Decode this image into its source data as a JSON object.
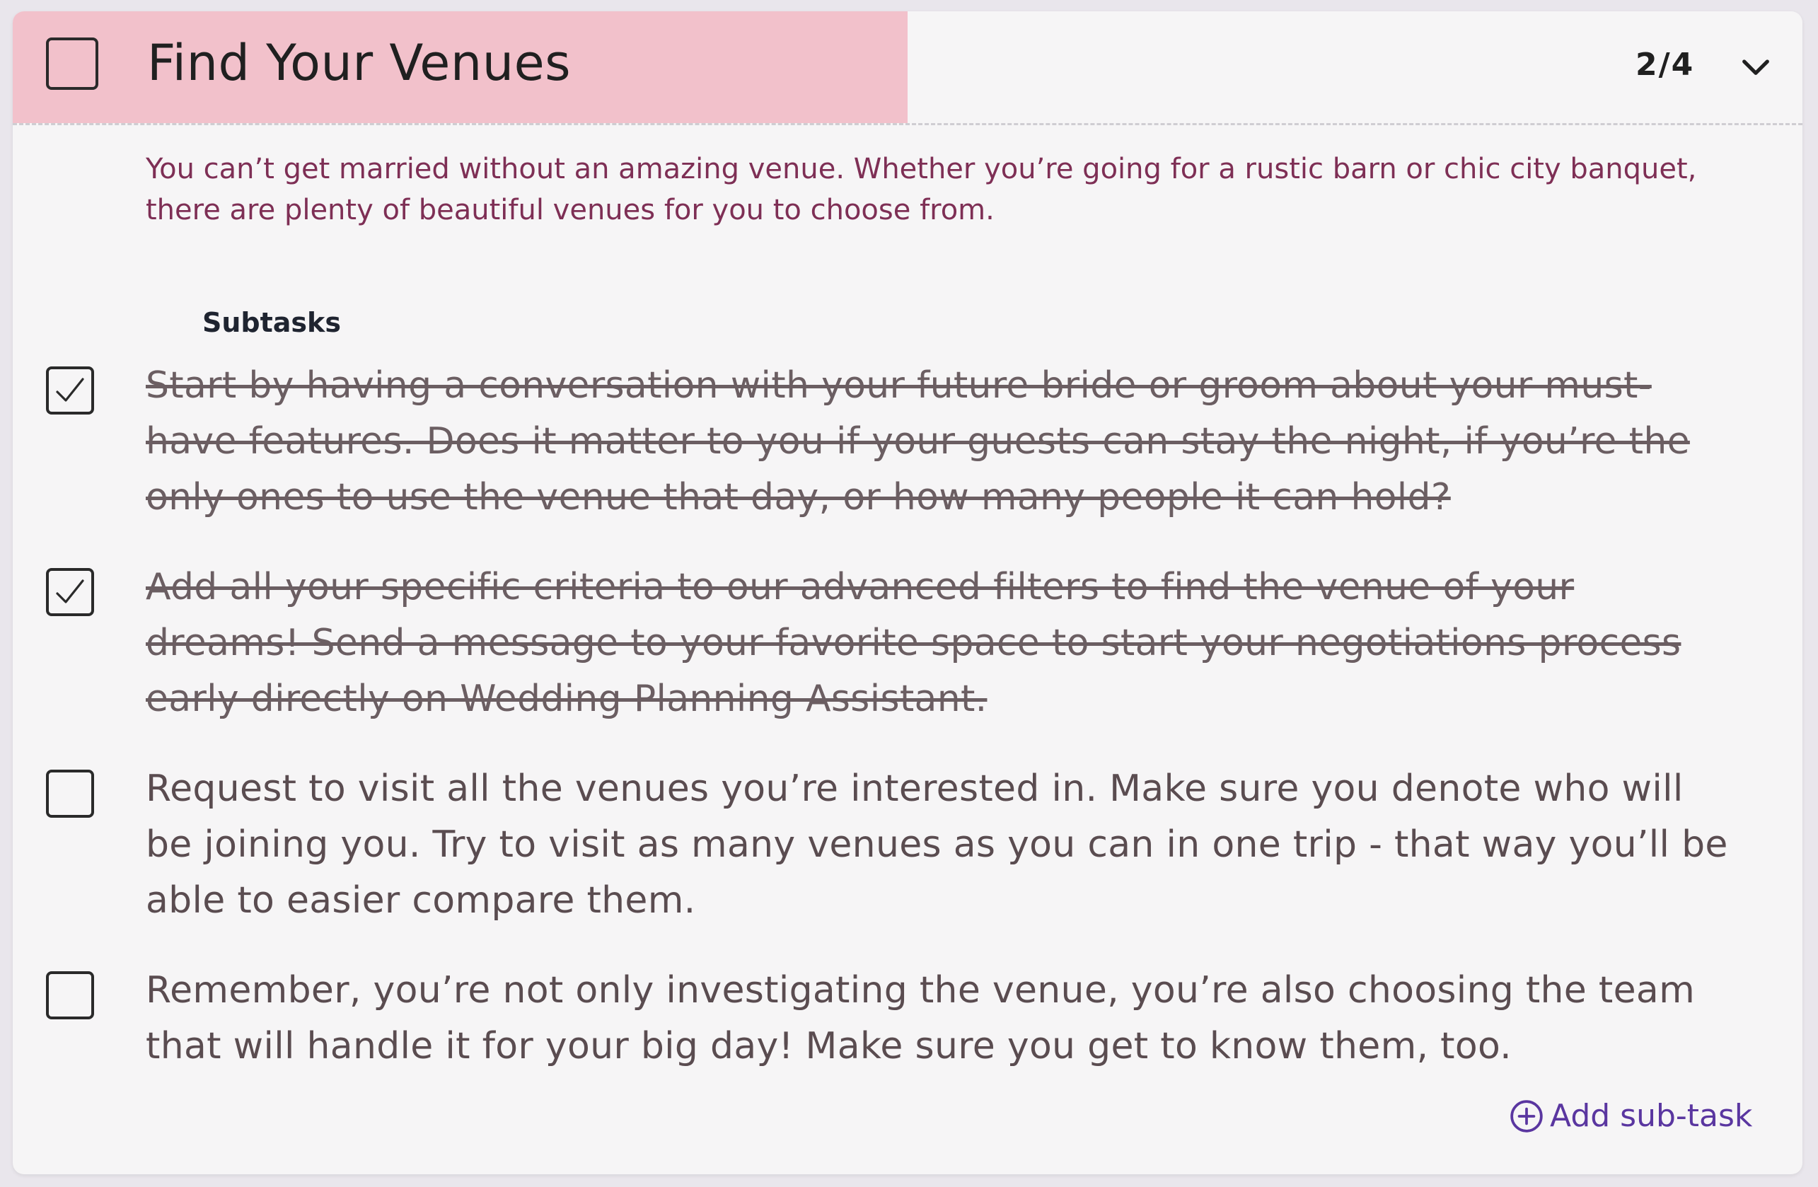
{
  "task": {
    "title": "Find Your Venues",
    "counter": "2/4",
    "progress_fraction": 0.5,
    "description": "You can’t get married without an amazing venue. Whether you’re going for a rustic barn or chic city banquet, there are plenty of beautiful venues for you to choose from.",
    "completed": false
  },
  "subtasks": {
    "heading": "Subtasks",
    "items": [
      {
        "text": "Start by having a conversation with your future bride or groom about your must-have features. Does it matter to you if your guests can stay the night, if you’re the only ones to use the venue that day, or how many people it can hold?",
        "checked": true
      },
      {
        "text": "Add all your specific criteria to our advanced filters to find the venue of your dreams! Send a message to your favorite space to start your negotiations process early directly on Wedding Planning Assistant.",
        "checked": true
      },
      {
        "text": "Request to visit all the venues you’re interested in. Make sure you denote who will be joining you. Try to visit as many venues as you can in one trip - that way you’ll be able to easier compare them.",
        "checked": false
      },
      {
        "text": "Remember, you’re not only investigating the venue, you’re also choosing the team that will handle it for your big day! Make sure you get to know them, too.",
        "checked": false
      }
    ]
  },
  "add_subtask": {
    "label": "Add sub-task"
  },
  "colors": {
    "progress": "#f2c1cb",
    "description": "#7e2f55",
    "accent": "#5a36a0"
  },
  "icons": {
    "expand": "chevron-down-icon",
    "add": "plus-circle-icon",
    "check": "checkmark-icon"
  }
}
